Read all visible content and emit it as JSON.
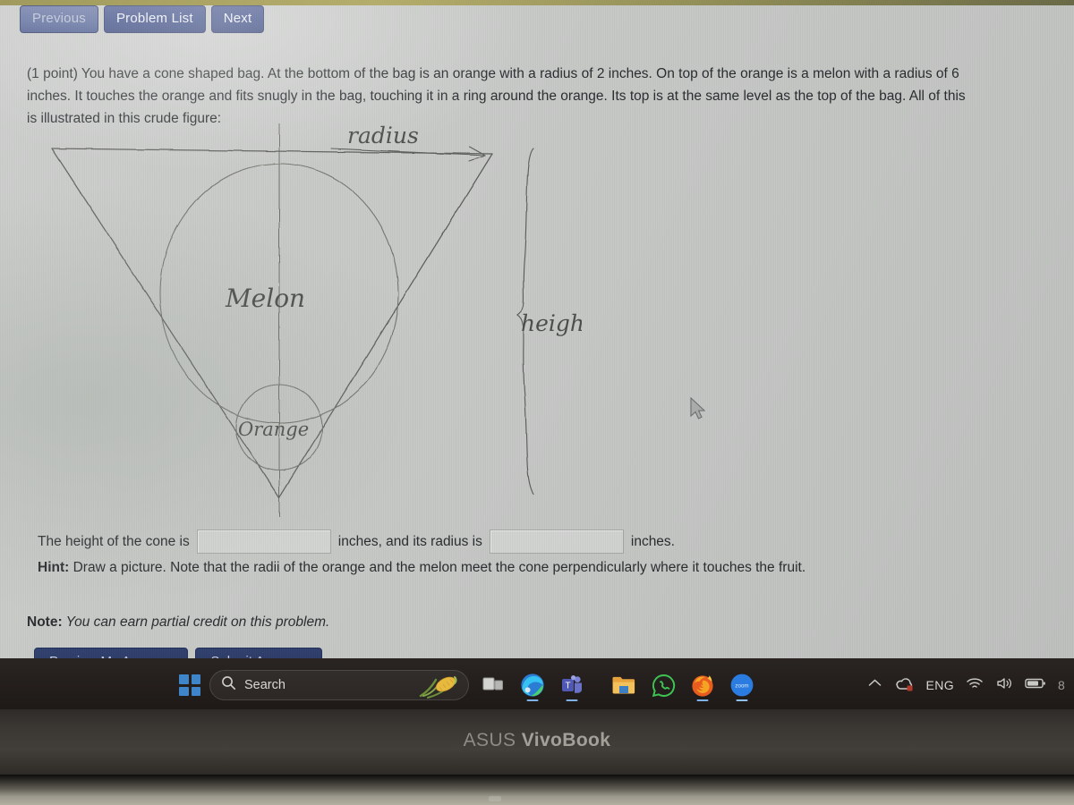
{
  "nav": {
    "previous_label": "Previous",
    "problem_list_label": "Problem List",
    "next_label": "Next"
  },
  "problem": {
    "points_label": "(1 point)",
    "statement": "You have a cone shaped bag. At the bottom of the bag is an orange with a radius of 2 inches. On top of the orange is a melon with a radius of 6 inches. It touches the orange and fits snugly in the bag, touching it in a ring around the orange. Its top is at the same level as the top of the bag. All of this is illustrated in this crude figure:"
  },
  "figure": {
    "radius_label": "radius",
    "height_label": "height",
    "melon_label": "Melon",
    "orange_label": "Orange"
  },
  "answer": {
    "prefix": "The height of the cone is",
    "middle": "inches, and its radius is",
    "suffix": "inches.",
    "height_value": "",
    "radius_value": "",
    "height_placeholder": "",
    "radius_placeholder": ""
  },
  "hint": {
    "label": "Hint:",
    "text": " Draw a picture. Note that the radii of the orange and the melon meet the cone perpendicularly where it touches the fruit."
  },
  "note": {
    "label": "Note:",
    "text": " You can earn partial credit on this problem."
  },
  "actions": {
    "preview_label": "Preview My Answers",
    "submit_label": "Submit Answers"
  },
  "taskbar": {
    "start_icon": "windows-start-icon",
    "search_placeholder": "Search",
    "search_value": "",
    "corn_icon": "corn-illustration-icon",
    "items": [
      {
        "icon": "task-view-icon",
        "name": "task-view"
      },
      {
        "icon": "microsoft-edge-icon",
        "name": "microsoft-edge"
      },
      {
        "icon": "microsoft-teams-icon",
        "name": "microsoft-teams"
      },
      {
        "icon": "file-explorer-icon",
        "name": "file-explorer"
      },
      {
        "icon": "whatsapp-icon",
        "name": "whatsapp"
      },
      {
        "icon": "firefox-icon",
        "name": "firefox"
      },
      {
        "icon": "zoom-icon",
        "name": "zoom"
      }
    ],
    "zoom_label": "zoom",
    "teams_label": "T",
    "tray": {
      "overflow_icon": "chevron-up-icon",
      "onedrive_icon": "onedrive-sync-icon",
      "language": "ENG",
      "wifi_icon": "wifi-icon",
      "volume_icon": "speaker-icon",
      "battery_icon": "battery-icon",
      "clock_partial": "8"
    }
  },
  "laptop": {
    "brand_primary": "ASUS",
    "brand_secondary": "VivoBook"
  },
  "colors": {
    "nav_button": "#3c4d87",
    "action_button": "#30406f",
    "screen_bg": "#c9cbc9",
    "taskbar_bg": "#241f1d",
    "bezel": "#3a3733",
    "start_blue": "#3f85c9"
  }
}
